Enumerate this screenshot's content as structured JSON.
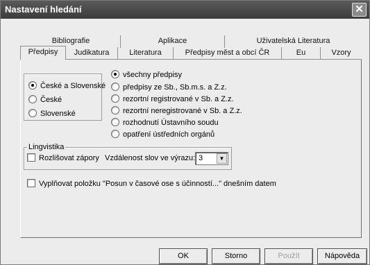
{
  "window": {
    "title": "Nastavení hledání",
    "close_glyph": "✕"
  },
  "tabs_row1": [
    {
      "label": "Bibliografie"
    },
    {
      "label": "Aplikace"
    },
    {
      "label": "Uživatelská Literatura"
    }
  ],
  "tabs_row2": [
    {
      "label": "Předpisy",
      "active": true
    },
    {
      "label": "Judikatura"
    },
    {
      "label": "Literatura"
    },
    {
      "label": "Předpisy měst a obcí ČR"
    },
    {
      "label": "Eu"
    },
    {
      "label": "Vzory"
    }
  ],
  "scope_group": {
    "options": [
      {
        "label": "České a Slovenské",
        "selected": true
      },
      {
        "label": "České",
        "selected": false
      },
      {
        "label": "Slovenské",
        "selected": false
      }
    ]
  },
  "type_options": [
    {
      "label": "všechny předpisy",
      "selected": true
    },
    {
      "label": "předpisy ze Sb., Sb.m.s. a Z.z.",
      "selected": false
    },
    {
      "label": "rezortní registrované v Sb. a Z.z.",
      "selected": false
    },
    {
      "label": "rezortní neregistrované v Sb. a Z.z.",
      "selected": false
    },
    {
      "label": "rozhodnutí Ústavního soudu",
      "selected": false
    },
    {
      "label": "opatření ústředních orgánů",
      "selected": false
    }
  ],
  "linguistics": {
    "legend": "Lingvistika",
    "negation_label": "Rozlišovat zápory",
    "negation_checked": false,
    "distance_label": "Vzdálenost slov ve výrazu:",
    "distance_value": "3"
  },
  "fill_option": {
    "label": "Vyplňovat položku \"Posun v časové ose s účinností...\" dnešním datem",
    "checked": false
  },
  "buttons": {
    "ok": "OK",
    "cancel": "Storno",
    "apply": "Použít",
    "help": "Nápověda"
  }
}
